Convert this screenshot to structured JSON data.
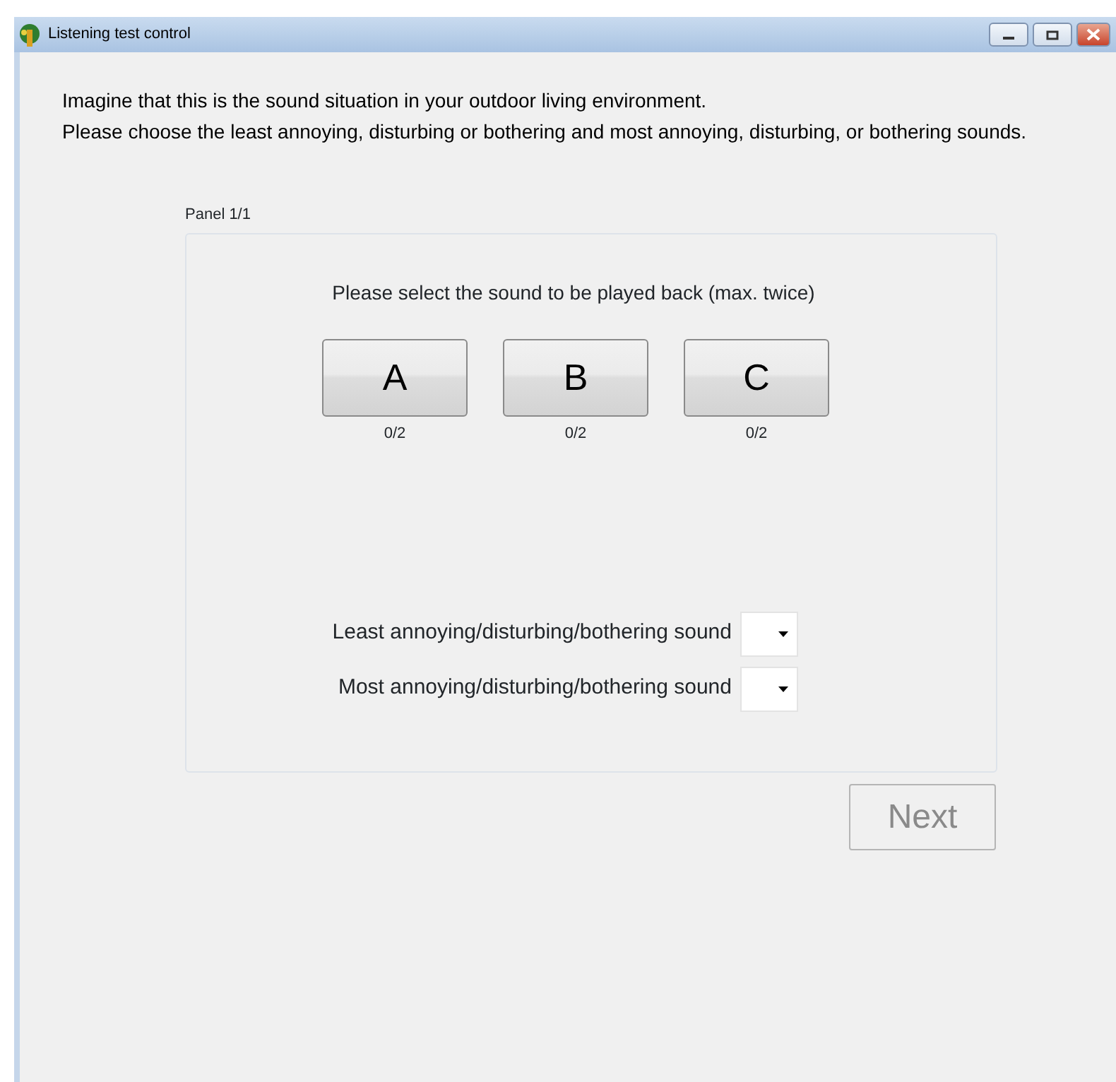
{
  "window": {
    "title": "Listening test control"
  },
  "instructions": [
    "Imagine that this is the sound situation in your outdoor living environment.",
    "Please choose the least annoying, disturbing or bothering and most annoying, disturbing, or bothering sounds."
  ],
  "panel": {
    "label": "Panel 1/1",
    "prompt": "Please select the sound to be played back (max. twice)",
    "sounds": [
      {
        "label": "A",
        "count": "0/2"
      },
      {
        "label": "B",
        "count": "0/2"
      },
      {
        "label": "C",
        "count": "0/2"
      }
    ],
    "ratings": [
      {
        "label": "Least annoying/disturbing/bothering sound"
      },
      {
        "label": "Most annoying/disturbing/bothering sound"
      }
    ]
  },
  "next_button": {
    "label": "Next",
    "disabled": true
  }
}
